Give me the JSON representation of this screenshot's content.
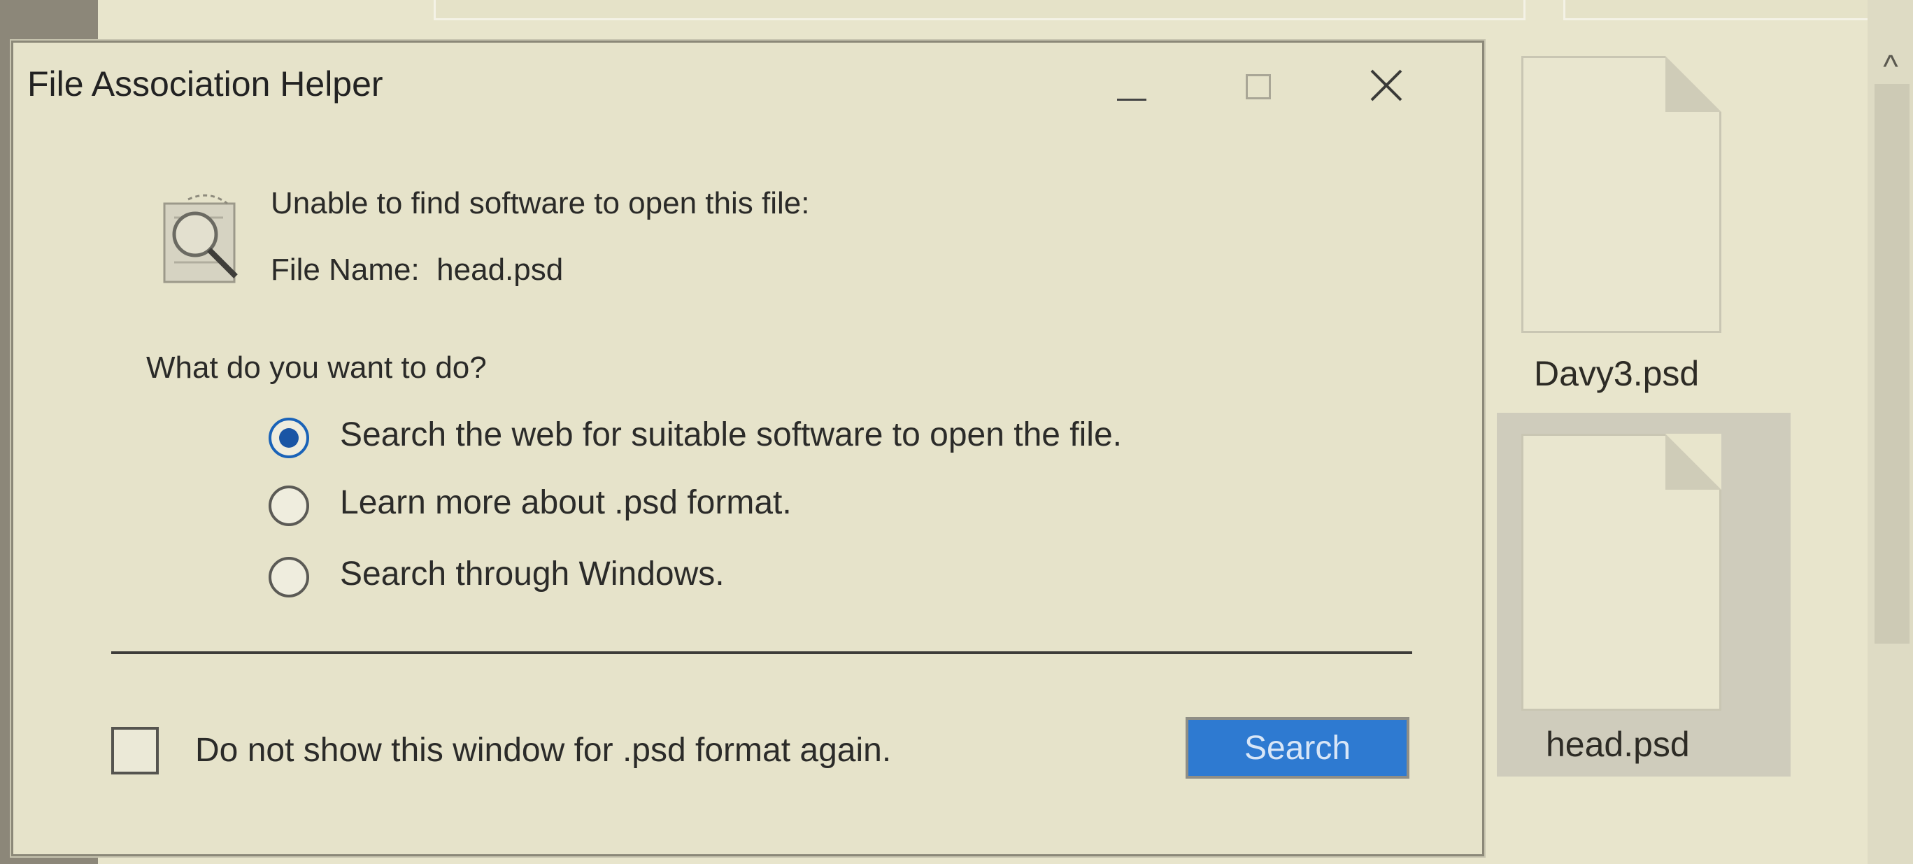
{
  "dialog": {
    "title": "File Association Helper",
    "message": "Unable to find software to open this file:",
    "file_name_label": "File Name:",
    "file_name": "head.psd",
    "question": "What do you want to do?",
    "options": [
      {
        "label": "Search the web for suitable software to open the file.",
        "selected": true
      },
      {
        "label": "Learn more about .psd format.",
        "selected": false
      },
      {
        "label": "Search through Windows.",
        "selected": false
      }
    ],
    "checkbox_label": "Do not show this window for .psd format again.",
    "checkbox_checked": false,
    "search_button": "Search",
    "icons": {
      "minimize": "minimize-icon",
      "maximize": "maximize-icon",
      "close": "close-icon",
      "helper": "search-magnifier-icon"
    }
  },
  "explorer": {
    "files": [
      {
        "name": "Davy3.psd",
        "selected": false
      },
      {
        "name": "head.psd",
        "selected": true
      }
    ],
    "scroll_up_icon": "chevron-up-icon"
  },
  "colors": {
    "accent": "#2e7ad1",
    "radio_selected": "#1a55a5",
    "dialog_bg": "#e6e3ca"
  }
}
